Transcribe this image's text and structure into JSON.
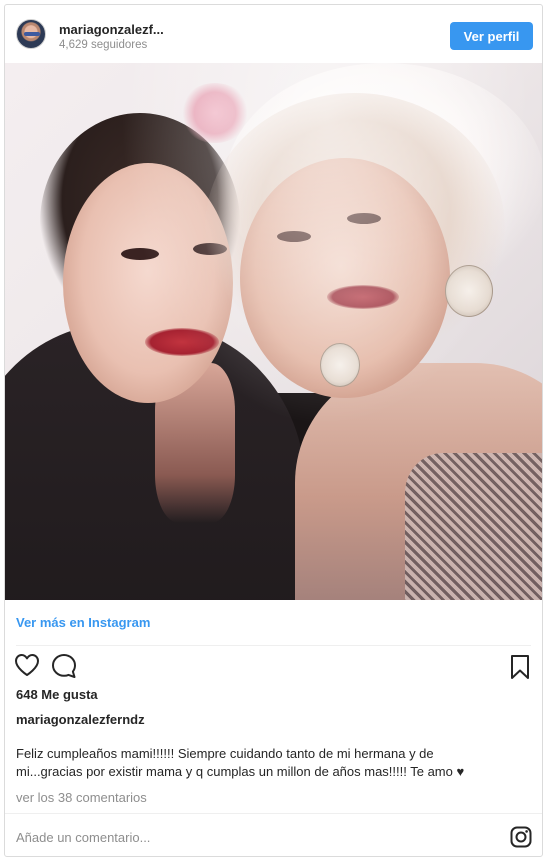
{
  "header": {
    "username": "mariagonzalezf...",
    "followers": "4,629 seguidores",
    "view_profile_label": "Ver perfil"
  },
  "post": {
    "view_more_label": "Ver más en Instagram",
    "likes": "648 Me gusta",
    "author": "mariagonzalezferndz",
    "caption_line1": "Feliz cumpleaños mami!!!!!! Siempre cuidando tanto de mi hermana y de",
    "caption_line2": "mi...gracias por existir mama y q cumplas un millon de años mas!!!!! Te amo ♥",
    "view_comments": "ver los 38 comentarios",
    "add_comment_placeholder": "Añade un comentario..."
  },
  "icons": {
    "like": "heart-icon",
    "comment": "comment-icon",
    "save": "bookmark-icon",
    "instagram": "instagram-icon"
  },
  "colors": {
    "accent": "#3897f0",
    "text": "#262626",
    "muted": "#8e8e8e",
    "border": "#dbdbdb"
  }
}
